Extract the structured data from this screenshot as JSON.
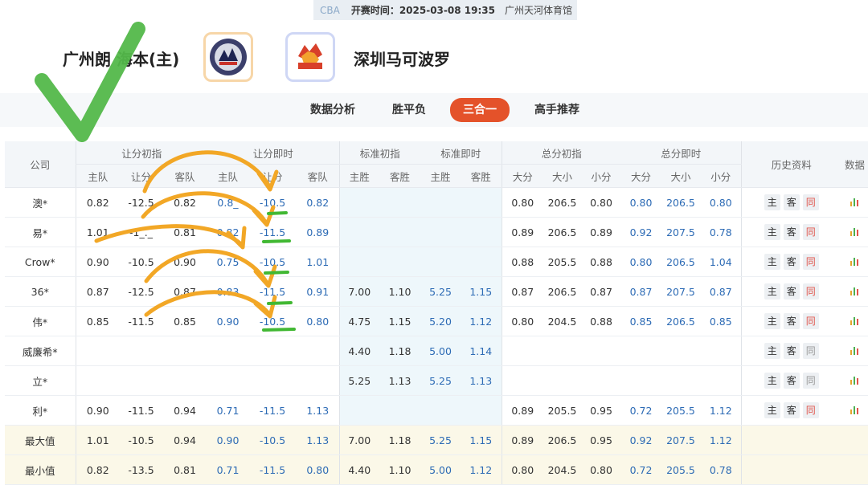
{
  "header": {
    "league": "CBA",
    "start_time": "开赛时间：2025-03-08 19:35",
    "venue": "广州天河体育馆"
  },
  "teams": {
    "home": "广州朗   海本(主)",
    "away": "深圳马可波罗",
    "home_logo_icon": "guangzhou-team-logo",
    "away_logo_icon": "shenzhen-team-logo"
  },
  "tabs": [
    "数据分析",
    "胜平负",
    "三合一",
    "高手推荐"
  ],
  "active_tab": "三合一",
  "colors": {
    "accent": "#e4522a",
    "blue_value": "#2d6bb5",
    "check": "#53b84a",
    "arrow": "#f2a726",
    "underline": "#41b833"
  },
  "table": {
    "group_headers": {
      "company": "公司",
      "handicap_open": "让分初指",
      "handicap_live": "让分即时",
      "std_open": "标准初指",
      "std_live": "标准即时",
      "total_open": "总分初指",
      "total_live": "总分即时",
      "history": "历史资料",
      "extra": "数据"
    },
    "sub_headers": {
      "handicap": [
        "主队",
        "让分",
        "客队"
      ],
      "std": [
        "主胜",
        "客胜"
      ],
      "total": [
        "大分",
        "大小",
        "小分"
      ]
    },
    "history_buttons": [
      "主",
      "客",
      "同"
    ],
    "rows": [
      {
        "company": "澳*",
        "ho": [
          "0.82",
          "-12.5",
          "0.82"
        ],
        "hl": [
          "0.8_",
          "-10.5",
          "0.82"
        ],
        "so": [
          "",
          ""
        ],
        "sl": [
          "",
          ""
        ],
        "to": [
          "0.80",
          "206.5",
          "0.80"
        ],
        "tl": [
          "0.80",
          "206.5",
          "0.80"
        ],
        "same": "active"
      },
      {
        "company": "易*",
        "ho": [
          "1.01",
          "-1_._",
          "0.81"
        ],
        "hl": [
          "0.82",
          "-11.5",
          "0.89"
        ],
        "so": [
          "",
          ""
        ],
        "sl": [
          "",
          ""
        ],
        "to": [
          "0.89",
          "206.5",
          "0.89"
        ],
        "tl": [
          "0.92",
          "207.5",
          "0.78"
        ],
        "same": "active"
      },
      {
        "company": "Crow*",
        "ho": [
          "0.90",
          "-10.5",
          "0.90"
        ],
        "hl": [
          "0.75",
          "-10.5",
          "1.01"
        ],
        "so": [
          "",
          ""
        ],
        "sl": [
          "",
          ""
        ],
        "to": [
          "0.88",
          "205.5",
          "0.88"
        ],
        "tl": [
          "0.80",
          "206.5",
          "1.04"
        ],
        "same": "active"
      },
      {
        "company": "36*",
        "ho": [
          "0.87",
          "-12.5",
          "0.87"
        ],
        "hl": [
          "0.83",
          "-11.5",
          "0.91"
        ],
        "so": [
          "7.00",
          "1.10"
        ],
        "sl": [
          "5.25",
          "1.15"
        ],
        "to": [
          "0.87",
          "206.5",
          "0.87"
        ],
        "tl": [
          "0.87",
          "207.5",
          "0.87"
        ],
        "same": "active"
      },
      {
        "company": "伟*",
        "ho": [
          "0.85",
          "-11.5",
          "0.85"
        ],
        "hl": [
          "0.90",
          "-10.5",
          "0.80"
        ],
        "so": [
          "4.75",
          "1.15"
        ],
        "sl": [
          "5.20",
          "1.12"
        ],
        "to": [
          "0.80",
          "204.5",
          "0.88"
        ],
        "tl": [
          "0.85",
          "206.5",
          "0.85"
        ],
        "same": "active"
      },
      {
        "company": "威廉希*",
        "ho": [
          "",
          "",
          ""
        ],
        "hl": [
          "",
          "",
          ""
        ],
        "so": [
          "4.40",
          "1.18"
        ],
        "sl": [
          "5.00",
          "1.14"
        ],
        "to": [
          "",
          "",
          ""
        ],
        "tl": [
          "",
          "",
          ""
        ],
        "same": "gray"
      },
      {
        "company": "立*",
        "ho": [
          "",
          "",
          ""
        ],
        "hl": [
          "",
          "",
          ""
        ],
        "so": [
          "5.25",
          "1.13"
        ],
        "sl": [
          "5.25",
          "1.13"
        ],
        "to": [
          "",
          "",
          ""
        ],
        "tl": [
          "",
          "",
          ""
        ],
        "same": "gray"
      },
      {
        "company": "利*",
        "ho": [
          "0.90",
          "-11.5",
          "0.94"
        ],
        "hl": [
          "0.71",
          "-11.5",
          "1.13"
        ],
        "so": [
          "",
          ""
        ],
        "sl": [
          "",
          ""
        ],
        "to": [
          "0.89",
          "205.5",
          "0.95"
        ],
        "tl": [
          "0.72",
          "205.5",
          "1.12"
        ],
        "same": "active"
      }
    ],
    "summary": [
      {
        "label": "最大值",
        "ho": [
          "1.01",
          "-10.5",
          "0.94"
        ],
        "hl": [
          "0.90",
          "-10.5",
          "1.13"
        ],
        "so": [
          "7.00",
          "1.18"
        ],
        "sl": [
          "5.25",
          "1.15"
        ],
        "to": [
          "0.89",
          "206.5",
          "0.95"
        ],
        "tl": [
          "0.92",
          "207.5",
          "1.12"
        ]
      },
      {
        "label": "最小值",
        "ho": [
          "0.82",
          "-13.5",
          "0.81"
        ],
        "hl": [
          "0.71",
          "-11.5",
          "0.80"
        ],
        "so": [
          "4.40",
          "1.10"
        ],
        "sl": [
          "5.00",
          "1.12"
        ],
        "to": [
          "0.80",
          "204.5",
          "0.80"
        ],
        "tl": [
          "0.72",
          "205.5",
          "0.78"
        ]
      }
    ]
  },
  "annotations": {
    "check_mark": "green-check-icon",
    "arrows": "hand-drawn-arrow-icon"
  }
}
